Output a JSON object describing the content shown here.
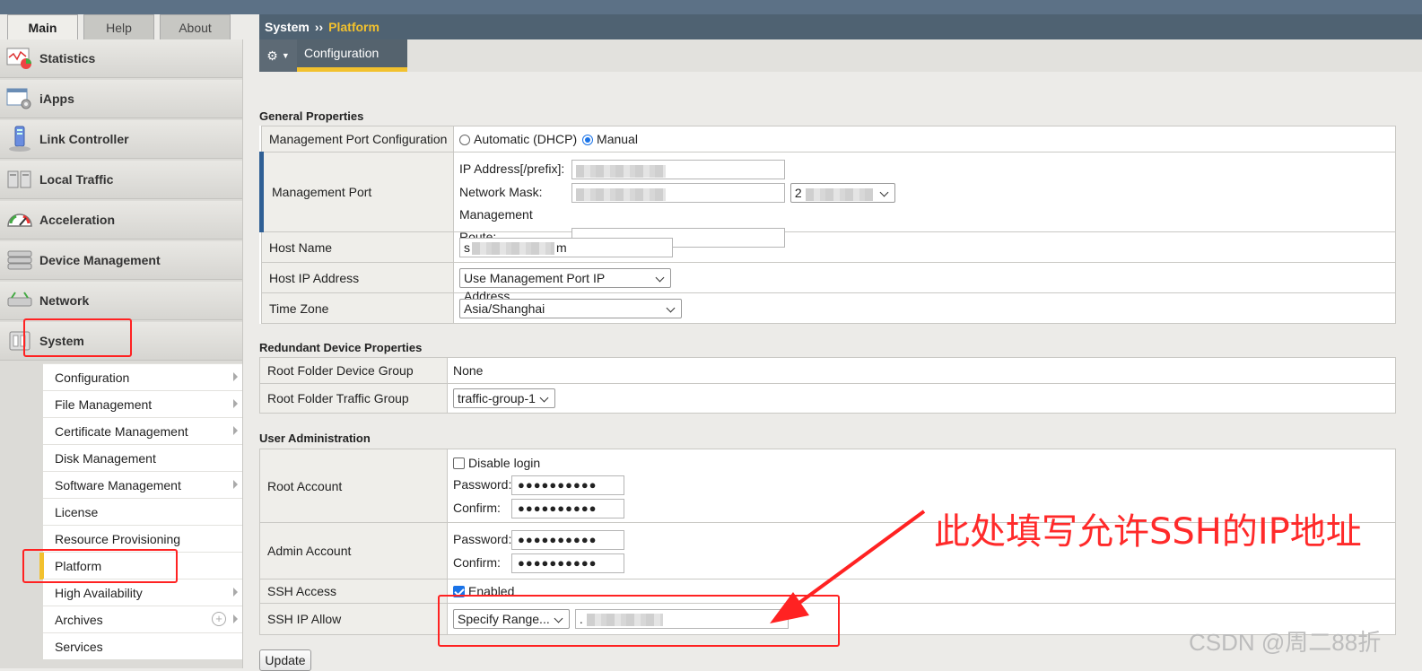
{
  "tabs": [
    {
      "label": "Main"
    },
    {
      "label": "Help"
    },
    {
      "label": "About"
    }
  ],
  "nav": {
    "items": [
      {
        "label": "Statistics",
        "icon": "statistics-icon"
      },
      {
        "label": "iApps",
        "icon": "iapps-icon"
      },
      {
        "label": "Link Controller",
        "icon": "link-controller-icon"
      },
      {
        "label": "Local Traffic",
        "icon": "local-traffic-icon"
      },
      {
        "label": "Acceleration",
        "icon": "acceleration-gauge-icon"
      },
      {
        "label": "Device Management",
        "icon": "device-management-icon"
      },
      {
        "label": "Network",
        "icon": "network-icon"
      },
      {
        "label": "System",
        "icon": "system-icon"
      }
    ],
    "system_submenu": [
      {
        "label": "Configuration"
      },
      {
        "label": "File Management"
      },
      {
        "label": "Certificate Management"
      },
      {
        "label": "Disk Management"
      },
      {
        "label": "Software Management"
      },
      {
        "label": "License"
      },
      {
        "label": "Resource Provisioning"
      },
      {
        "label": "Platform"
      },
      {
        "label": "High Availability"
      },
      {
        "label": "Archives"
      },
      {
        "label": "Services"
      }
    ]
  },
  "breadcrumb": {
    "parent": "System",
    "separator": "››",
    "current": "Platform"
  },
  "subtabs": {
    "configuration": "Configuration"
  },
  "general": {
    "title": "General Properties",
    "mgmt_port_config": {
      "label": "Management Port Configuration",
      "option_auto": "Automatic (DHCP)",
      "option_manual": "Manual",
      "selected": "Manual"
    },
    "mgmt_port": {
      "label": "Management Port",
      "ip_label": "IP Address[/prefix]:",
      "mask_label": "Network Mask:",
      "mask_select_value": "2",
      "route_label": "Management Route:"
    },
    "host_name": {
      "label": "Host Name",
      "value_prefix": "s",
      "value_suffix": "m"
    },
    "host_ip": {
      "label": "Host IP Address",
      "value": "Use Management Port IP Address"
    },
    "time_zone": {
      "label": "Time Zone",
      "value": "Asia/Shanghai"
    }
  },
  "redundant": {
    "title": "Redundant Device Properties",
    "root_device_group": {
      "label": "Root Folder Device Group",
      "value": "None"
    },
    "root_traffic_group": {
      "label": "Root Folder Traffic Group",
      "value": "traffic-group-1"
    }
  },
  "users": {
    "title": "User Administration",
    "root": {
      "label": "Root Account",
      "disable_login": "Disable login",
      "password_label": "Password:",
      "password": "●●●●●●●●●●",
      "confirm_label": "Confirm:",
      "confirm": "●●●●●●●●●●"
    },
    "admin": {
      "label": "Admin Account",
      "password_label": "Password:",
      "password": "●●●●●●●●●●",
      "confirm_label": "Confirm:",
      "confirm": "●●●●●●●●●●"
    },
    "ssh_access": {
      "label": "SSH Access",
      "value": "Enabled",
      "checked": true
    },
    "ssh_ip_allow": {
      "label": "SSH IP Allow",
      "select_value": "Specify Range...",
      "input_prefix": "."
    }
  },
  "buttons": {
    "update": "Update"
  },
  "annotation": {
    "text": "此处填写允许SSH的IP地址"
  },
  "watermark": "CSDN @周二88折",
  "colors": {
    "accent": "#f2c12e",
    "header": "#4f6272",
    "annotation": "#ff2222",
    "checkbox": "#1a73e8"
  }
}
